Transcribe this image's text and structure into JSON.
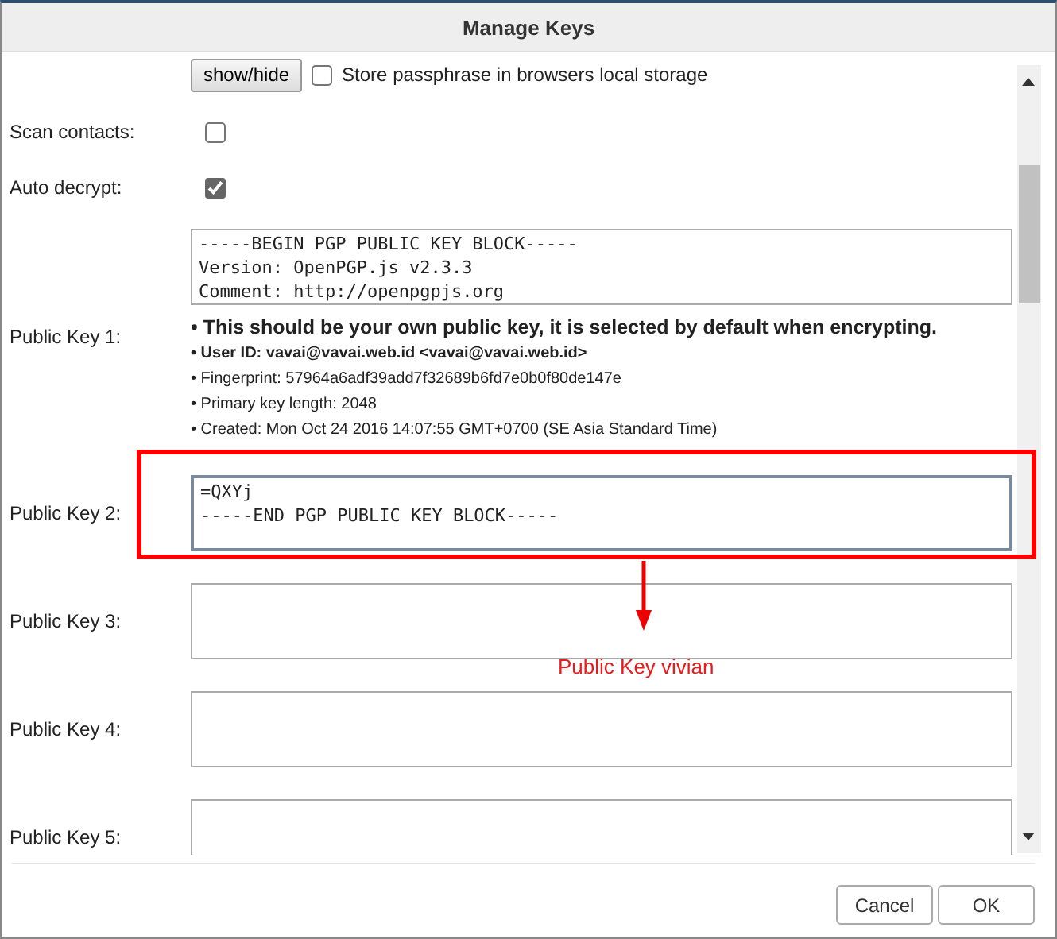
{
  "window": {
    "title": "Manage Keys"
  },
  "passphrase": {
    "button": "show/hide",
    "store_label": "Store passphrase in browsers local storage",
    "store_checked": false
  },
  "options": [
    {
      "label": "Scan contacts:",
      "checked": false
    },
    {
      "label": "Auto decrypt:",
      "checked": true
    }
  ],
  "public_keys": [
    {
      "label": "Public Key 1:",
      "value": "-----BEGIN PGP PUBLIC KEY BLOCK-----\nVersion: OpenPGP.js v2.3.3\nComment: http://openpgpjs.org",
      "focused": false,
      "info": [
        {
          "kind": "notice",
          "text": "• This should be your own public key, it is selected by default when encrypting."
        },
        {
          "kind": "bold",
          "text": "• User ID: vavai@vavai.web.id <vavai@vavai.web.id>"
        },
        {
          "kind": "plain",
          "text": "• Fingerprint: 57964a6adf39add7f32689b6fd7e0b0f80de147e"
        },
        {
          "kind": "plain",
          "text": "• Primary key length: 2048"
        },
        {
          "kind": "plain",
          "text": "• Created: Mon Oct 24 2016 14:07:55 GMT+0700 (SE Asia Standard Time)"
        }
      ]
    },
    {
      "label": "Public Key 2:",
      "value": "=QXYj\n-----END PGP PUBLIC KEY BLOCK-----",
      "focused": true
    },
    {
      "label": "Public Key 3:",
      "focused": false
    },
    {
      "label": "Public Key 4:",
      "focused": false
    },
    {
      "label": "Public Key 5:",
      "focused": false
    }
  ],
  "annotation": {
    "text": "Public Key vivian"
  },
  "buttons": [
    "Cancel",
    "OK"
  ]
}
